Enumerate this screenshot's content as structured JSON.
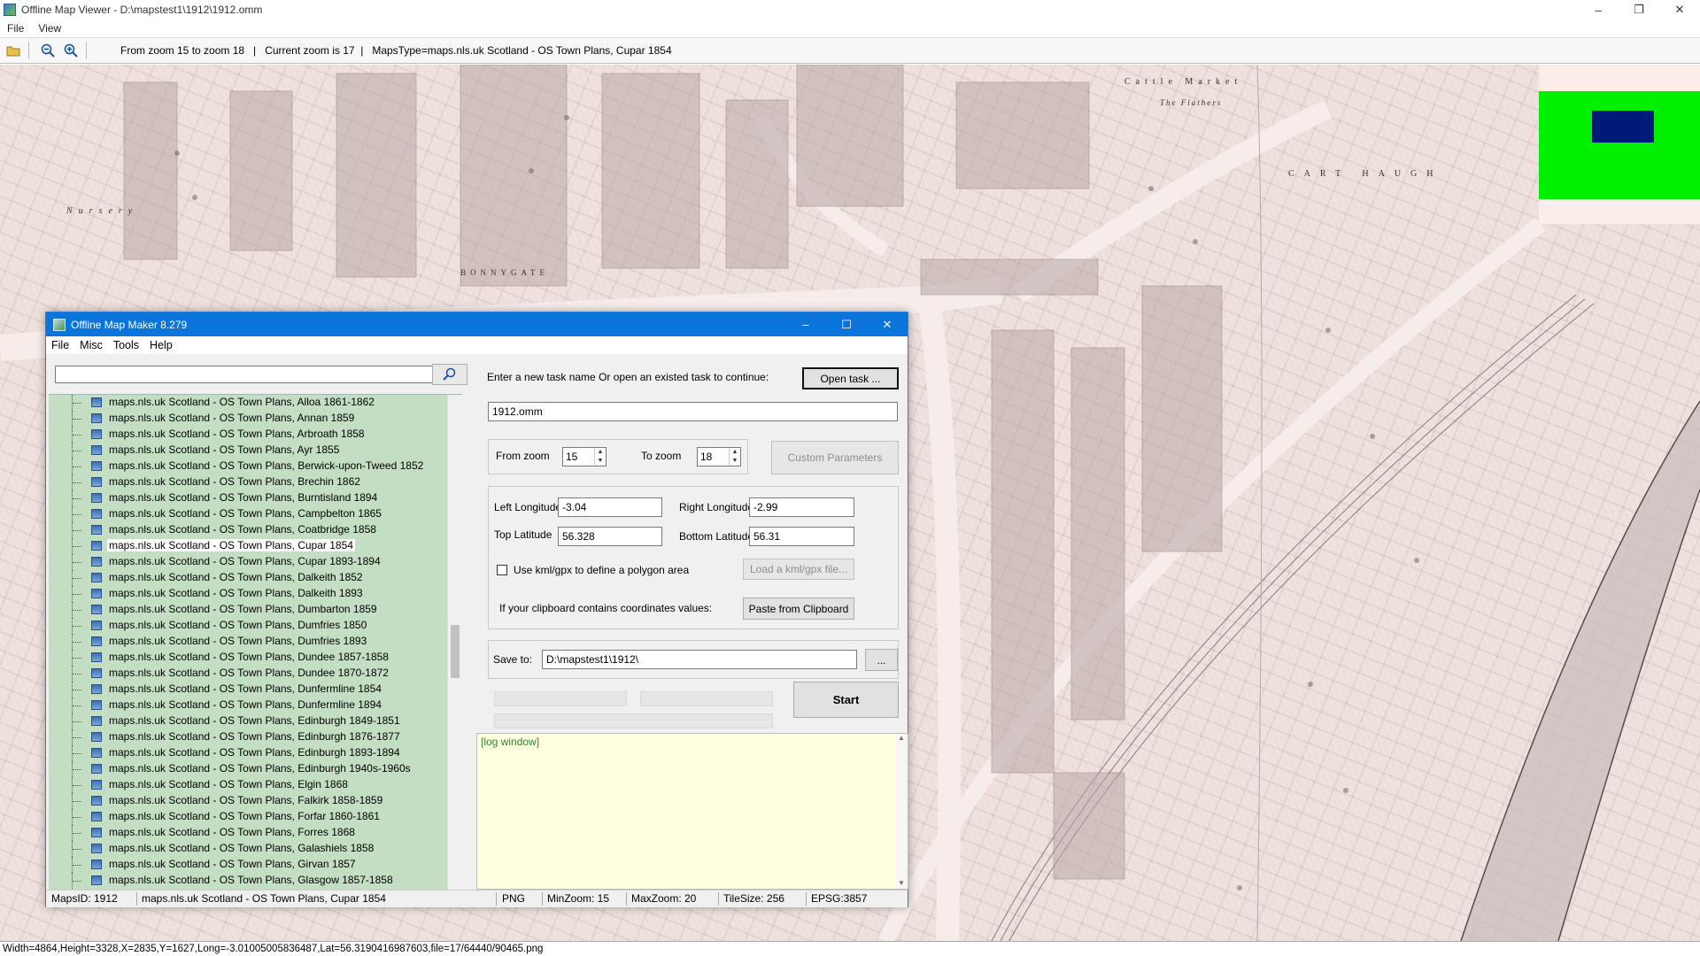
{
  "viewer": {
    "title": "Offline Map Viewer - D:\\mapstest1\\1912\\1912.omm",
    "menu": [
      "File",
      "View"
    ],
    "toolbar_status": "From zoom 15 to zoom 18   |   Current zoom is 17  |   MapsType=maps.nls.uk Scotland - OS Town Plans, Cupar 1854",
    "statusbar": "Width=4864,Height=3328,X=2835,Y=1627,Long=-3.01005005836487,Lat=56.3190416987603,file=17/64440/90465.png"
  },
  "map": {
    "labels": {
      "cattle_market": "Cattle Market",
      "the_flathers": "The Flathers",
      "cart_haugh": "CART HAUGH",
      "nursery": "Nursery",
      "bonnygate": "BONNYGATE"
    },
    "overview_colors": {
      "frame": "#00f000",
      "viewport": "#001a7a"
    }
  },
  "omm": {
    "title": "Offline Map Maker 8.279",
    "menu": [
      "File",
      "Misc",
      "Tools",
      "Help"
    ],
    "search": {
      "value": ""
    },
    "tree_items": [
      "maps.nls.uk Scotland - OS Town Plans, Alloa 1861-1862",
      "maps.nls.uk Scotland - OS Town Plans, Annan 1859",
      "maps.nls.uk Scotland - OS Town Plans, Arbroath 1858",
      "maps.nls.uk Scotland - OS Town Plans, Ayr 1855",
      "maps.nls.uk Scotland - OS Town Plans, Berwick-upon-Tweed 1852",
      "maps.nls.uk Scotland - OS Town Plans, Brechin 1862",
      "maps.nls.uk Scotland - OS Town Plans, Burntisland 1894",
      "maps.nls.uk Scotland - OS Town Plans, Campbelton 1865",
      "maps.nls.uk Scotland - OS Town Plans, Coatbridge 1858",
      "maps.nls.uk Scotland - OS Town Plans, Cupar 1854",
      "maps.nls.uk Scotland - OS Town Plans, Cupar 1893-1894",
      "maps.nls.uk Scotland - OS Town Plans, Dalkeith 1852",
      "maps.nls.uk Scotland - OS Town Plans, Dalkeith 1893",
      "maps.nls.uk Scotland - OS Town Plans, Dumbarton 1859",
      "maps.nls.uk Scotland - OS Town Plans, Dumfries 1850",
      "maps.nls.uk Scotland - OS Town Plans, Dumfries 1893",
      "maps.nls.uk Scotland - OS Town Plans, Dundee 1857-1858",
      "maps.nls.uk Scotland - OS Town Plans, Dundee 1870-1872",
      "maps.nls.uk Scotland - OS Town Plans, Dunfermline 1854",
      "maps.nls.uk Scotland - OS Town Plans, Dunfermline 1894",
      "maps.nls.uk Scotland - OS Town Plans, Edinburgh 1849-1851",
      "maps.nls.uk Scotland - OS Town Plans, Edinburgh 1876-1877",
      "maps.nls.uk Scotland - OS Town Plans, Edinburgh 1893-1894",
      "maps.nls.uk Scotland - OS Town Plans, Edinburgh 1940s-1960s",
      "maps.nls.uk Scotland - OS Town Plans, Elgin 1868",
      "maps.nls.uk Scotland - OS Town Plans, Falkirk 1858-1859",
      "maps.nls.uk Scotland - OS Town Plans, Forfar 1860-1861",
      "maps.nls.uk Scotland - OS Town Plans, Forres 1868",
      "maps.nls.uk Scotland - OS Town Plans, Galashiels 1858",
      "maps.nls.uk Scotland - OS Town Plans, Girvan 1857",
      "maps.nls.uk Scotland - OS Town Plans, Glasgow 1857-1858"
    ],
    "selected_index": 9,
    "task_prompt": "Enter a new task name Or open an existed task to continue:",
    "open_task_label": "Open task ...",
    "task_name": "1912.omm",
    "from_zoom_label": "From zoom",
    "from_zoom": "15",
    "to_zoom_label": "To zoom",
    "to_zoom": "18",
    "custom_params_label": "Custom Parameters",
    "left_lon_label": "Left Longitude",
    "left_lon": "-3.04",
    "right_lon_label": "Right Longitude",
    "right_lon": "-2.99",
    "top_lat_label": "Top Latitude",
    "top_lat": "56.328",
    "bottom_lat_label": "Bottom Latitude",
    "bottom_lat": "56.31",
    "kml_checkbox_label": "Use kml/gpx to define a polygon area",
    "kml_checked": false,
    "load_kml_label": "Load a kml/gpx file...",
    "clipboard_prompt": "If your clipboard contains coordinates values:",
    "paste_label": "Paste from Clipboard",
    "save_to_label": "Save to:",
    "save_to": "D:\\mapstest1\\1912\\",
    "browse_label": "...",
    "start_label": "Start",
    "log_text": "[log window]",
    "status": {
      "maps_id": "MapsID: 1912",
      "maps_name": "maps.nls.uk Scotland - OS Town Plans, Cupar 1854",
      "format": "PNG",
      "min_zoom": "MinZoom: 15",
      "max_zoom": "MaxZoom: 20",
      "tile_size": "TileSize: 256",
      "epsg": "EPSG:3857"
    }
  }
}
